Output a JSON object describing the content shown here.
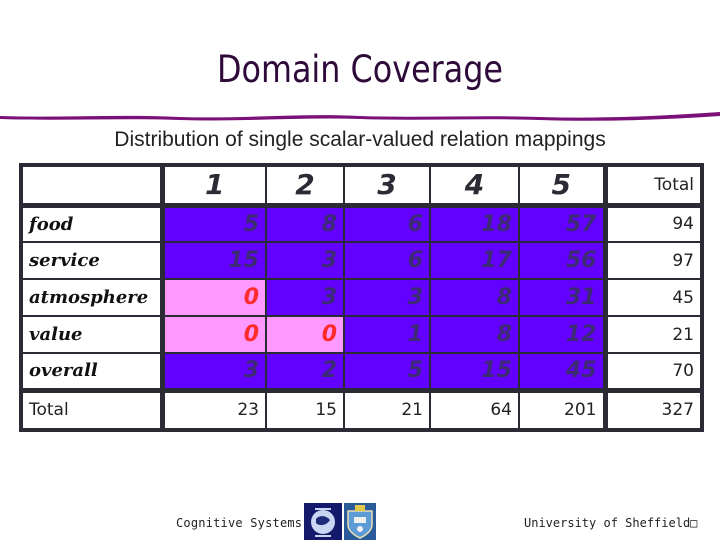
{
  "slide": {
    "title": "Domain Coverage",
    "subtitle": "Distribution of single scalar-valued relation mappings"
  },
  "table": {
    "columns": [
      "1",
      "2",
      "3",
      "4",
      "5"
    ],
    "total_header": "Total",
    "rows": [
      {
        "label": "food",
        "values": [
          "5",
          "8",
          "6",
          "18",
          "57"
        ],
        "total": "94"
      },
      {
        "label": "service",
        "values": [
          "15",
          "3",
          "6",
          "17",
          "56"
        ],
        "total": "97"
      },
      {
        "label": "atmosphere",
        "values": [
          "0",
          "3",
          "3",
          "8",
          "31"
        ],
        "total": "45"
      },
      {
        "label": "value",
        "values": [
          "0",
          "0",
          "1",
          "8",
          "12"
        ],
        "total": "21"
      },
      {
        "label": "overall",
        "values": [
          "3",
          "2",
          "5",
          "15",
          "45"
        ],
        "total": "70"
      }
    ],
    "total_row": {
      "label": "Total",
      "values": [
        "23",
        "15",
        "21",
        "64",
        "201"
      ],
      "total": "327"
    },
    "colors": {
      "nonzero_fill": "#6400ff",
      "zero_fill": "#ff99ff",
      "zero_text": "#ff2a2a"
    }
  },
  "footer": {
    "left_text": "Cognitive Systems",
    "right_text": "University of Sheffield□",
    "logos": [
      "university-crest-globe-logo",
      "university-shield-logo"
    ]
  }
}
